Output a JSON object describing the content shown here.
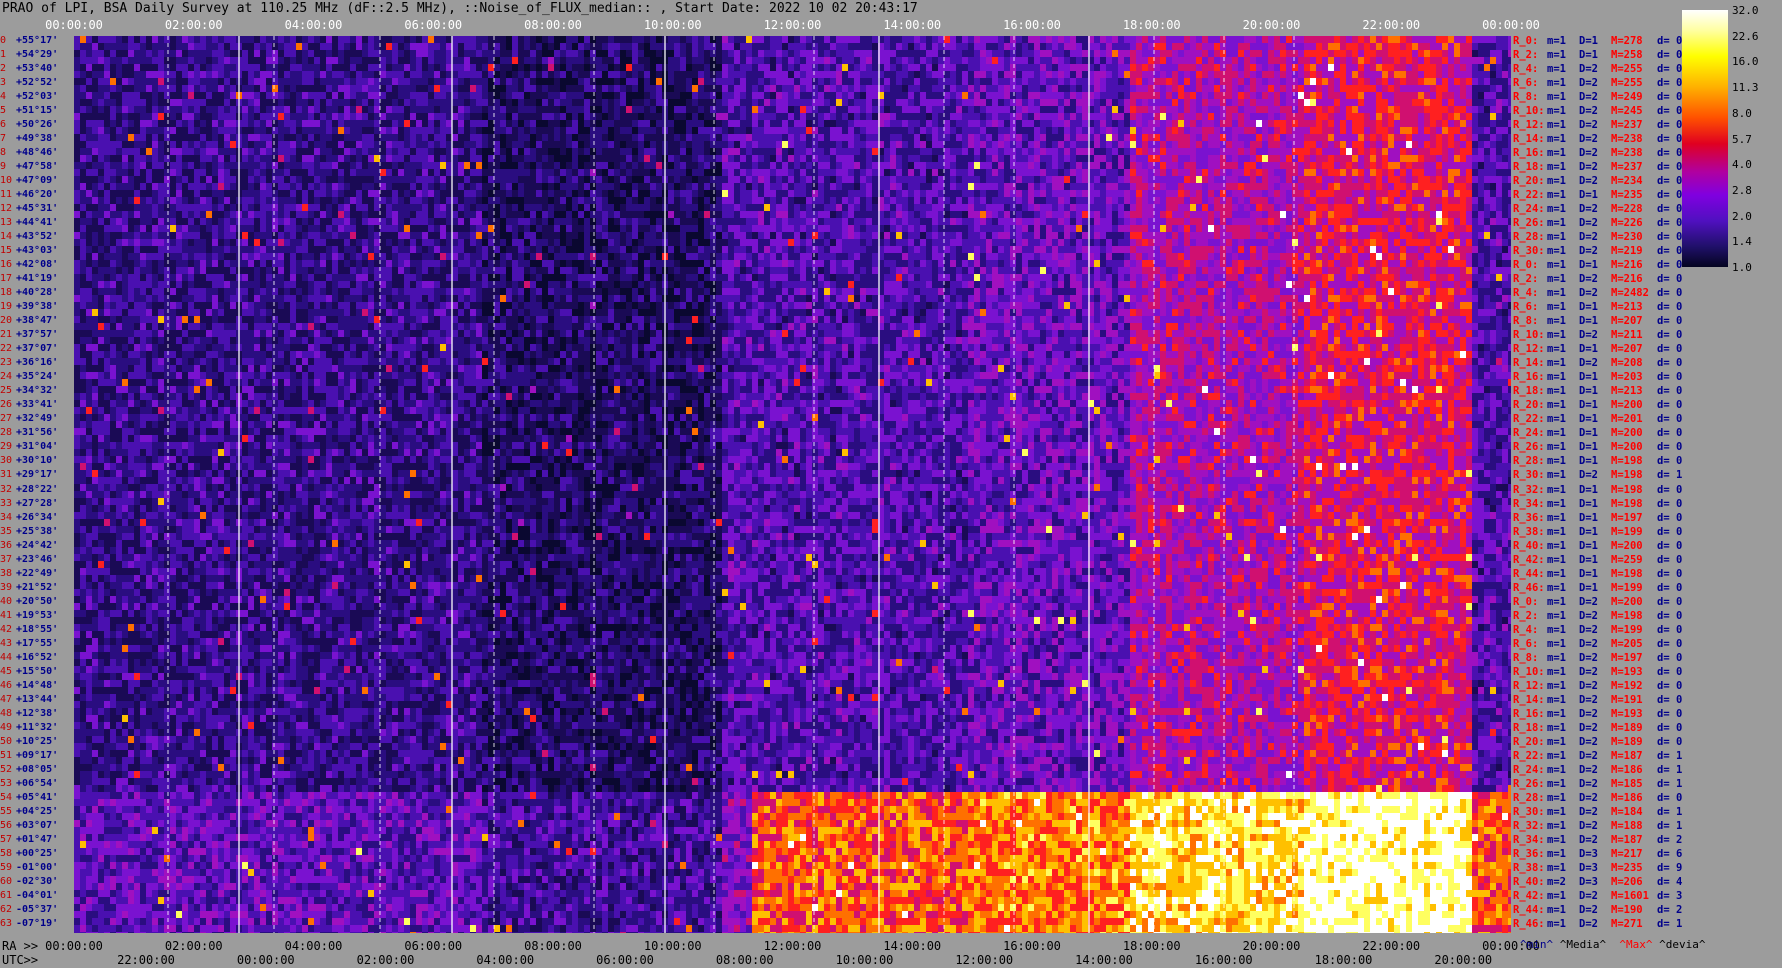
{
  "title": "PRAO of LPI, BSA Daily Survey at 110.25 MHz (dF::2.5 MHz), ::Noise_of_FLUX_median:: , Start Date: 2022 10 02 20:43:17",
  "top_axis": [
    "00:00:00",
    "02:00:00",
    "04:00:00",
    "06:00:00",
    "08:00:00",
    "10:00:00",
    "12:00:00",
    "14:00:00",
    "16:00:00",
    "18:00:00",
    "20:00:00",
    "22:00:00",
    "00:00:00"
  ],
  "bottom_ra_prefix": "RA >>",
  "bottom_ra": [
    "00:00:00",
    "02:00:00",
    "04:00:00",
    "06:00:00",
    "08:00:00",
    "10:00:00",
    "12:00:00",
    "14:00:00",
    "16:00:00",
    "18:00:00",
    "20:00:00",
    "22:00:00",
    "00:00:00"
  ],
  "bottom_utc_prefix": "UTC>>",
  "bottom_utc": [
    "22:00:00",
    "00:00:00",
    "02:00:00",
    "04:00:00",
    "06:00:00",
    "08:00:00",
    "10:00:00",
    "12:00:00",
    "14:00:00",
    "16:00:00",
    "18:00:00",
    "20:00:00"
  ],
  "colorbar": {
    "ticks": [
      "32.0",
      "22.6",
      "16.0",
      "11.3",
      "8.0",
      "5.7",
      "4.0",
      "2.8",
      "2.0",
      "1.4",
      "1.0"
    ]
  },
  "legend": {
    "min": "^min^",
    "median": "^Media^",
    "max": "^Max^",
    "devia": "^devia^"
  },
  "declinations": [
    {
      "i": "0",
      "d": "+55°17'"
    },
    {
      "i": "1",
      "d": "+54°29'"
    },
    {
      "i": "2",
      "d": "+53°40'"
    },
    {
      "i": "3",
      "d": "+52°52'"
    },
    {
      "i": "4",
      "d": "+52°03'"
    },
    {
      "i": "5",
      "d": "+51°15'"
    },
    {
      "i": "6",
      "d": "+50°26'"
    },
    {
      "i": "7",
      "d": "+49°38'"
    },
    {
      "i": "8",
      "d": "+48°46'"
    },
    {
      "i": "9",
      "d": "+47°58'"
    },
    {
      "i": "10",
      "d": "+47°09'"
    },
    {
      "i": "11",
      "d": "+46°20'"
    },
    {
      "i": "12",
      "d": "+45°31'"
    },
    {
      "i": "13",
      "d": "+44°41'"
    },
    {
      "i": "14",
      "d": "+43°52'"
    },
    {
      "i": "15",
      "d": "+43°03'"
    },
    {
      "i": "16",
      "d": "+42°08'"
    },
    {
      "i": "17",
      "d": "+41°19'"
    },
    {
      "i": "18",
      "d": "+40°28'"
    },
    {
      "i": "19",
      "d": "+39°38'"
    },
    {
      "i": "20",
      "d": "+38°47'"
    },
    {
      "i": "21",
      "d": "+37°57'"
    },
    {
      "i": "22",
      "d": "+37°07'"
    },
    {
      "i": "23",
      "d": "+36°16'"
    },
    {
      "i": "24",
      "d": "+35°24'"
    },
    {
      "i": "25",
      "d": "+34°32'"
    },
    {
      "i": "26",
      "d": "+33°41'"
    },
    {
      "i": "27",
      "d": "+32°49'"
    },
    {
      "i": "28",
      "d": "+31°56'"
    },
    {
      "i": "29",
      "d": "+31°04'"
    },
    {
      "i": "30",
      "d": "+30°10'"
    },
    {
      "i": "31",
      "d": "+29°17'"
    },
    {
      "i": "32",
      "d": "+28°22'"
    },
    {
      "i": "33",
      "d": "+27°28'"
    },
    {
      "i": "34",
      "d": "+26°34'"
    },
    {
      "i": "35",
      "d": "+25°38'"
    },
    {
      "i": "36",
      "d": "+24°42'"
    },
    {
      "i": "37",
      "d": "+23°46'"
    },
    {
      "i": "38",
      "d": "+22°49'"
    },
    {
      "i": "39",
      "d": "+21°52'"
    },
    {
      "i": "40",
      "d": "+20°50'"
    },
    {
      "i": "41",
      "d": "+19°53'"
    },
    {
      "i": "42",
      "d": "+18°55'"
    },
    {
      "i": "43",
      "d": "+17°55'"
    },
    {
      "i": "44",
      "d": "+16°52'"
    },
    {
      "i": "45",
      "d": "+15°50'"
    },
    {
      "i": "46",
      "d": "+14°48'"
    },
    {
      "i": "47",
      "d": "+13°44'"
    },
    {
      "i": "48",
      "d": "+12°38'"
    },
    {
      "i": "49",
      "d": "+11°32'"
    },
    {
      "i": "50",
      "d": "+10°25'"
    },
    {
      "i": "51",
      "d": "+09°17'"
    },
    {
      "i": "52",
      "d": "+08°05'"
    },
    {
      "i": "53",
      "d": "+06°54'"
    },
    {
      "i": "54",
      "d": "+05°41'"
    },
    {
      "i": "55",
      "d": "+04°25'"
    },
    {
      "i": "56",
      "d": "+03°07'"
    },
    {
      "i": "57",
      "d": "+01°47'"
    },
    {
      "i": "58",
      "d": "+00°25'"
    },
    {
      "i": "59",
      "d": "-01°00'"
    },
    {
      "i": "60",
      "d": "-02°30'"
    },
    {
      "i": "61",
      "d": "-04°01'"
    },
    {
      "i": "62",
      "d": "-05°37'"
    },
    {
      "i": "63",
      "d": "-07°19'"
    }
  ],
  "stats": [
    {
      "r": "R_0:",
      "m": "m=1",
      "D": "D=1",
      "M": "M=278",
      "d": "d= 0"
    },
    {
      "r": "R_2:",
      "m": "m=1",
      "D": "D=1",
      "M": "M=258",
      "d": "d= 0"
    },
    {
      "r": "R_4:",
      "m": "m=1",
      "D": "D=2",
      "M": "M=255",
      "d": "d= 0"
    },
    {
      "r": "R_6:",
      "m": "m=1",
      "D": "D=2",
      "M": "M=255",
      "d": "d= 0"
    },
    {
      "r": "R_8:",
      "m": "m=1",
      "D": "D=2",
      "M": "M=249",
      "d": "d= 0"
    },
    {
      "r": "R_10:",
      "m": "m=1",
      "D": "D=2",
      "M": "M=245",
      "d": "d= 0"
    },
    {
      "r": "R_12:",
      "m": "m=1",
      "D": "D=2",
      "M": "M=237",
      "d": "d= 0"
    },
    {
      "r": "R_14:",
      "m": "m=1",
      "D": "D=2",
      "M": "M=238",
      "d": "d= 0"
    },
    {
      "r": "R_16:",
      "m": "m=1",
      "D": "D=2",
      "M": "M=238",
      "d": "d= 0"
    },
    {
      "r": "R_18:",
      "m": "m=1",
      "D": "D=2",
      "M": "M=237",
      "d": "d= 0"
    },
    {
      "r": "R_20:",
      "m": "m=1",
      "D": "D=2",
      "M": "M=234",
      "d": "d= 0"
    },
    {
      "r": "R_22:",
      "m": "m=1",
      "D": "D=1",
      "M": "M=235",
      "d": "d= 0"
    },
    {
      "r": "R_24:",
      "m": "m=1",
      "D": "D=2",
      "M": "M=228",
      "d": "d= 0"
    },
    {
      "r": "R_26:",
      "m": "m=1",
      "D": "D=2",
      "M": "M=226",
      "d": "d= 0"
    },
    {
      "r": "R_28:",
      "m": "m=1",
      "D": "D=2",
      "M": "M=230",
      "d": "d= 0"
    },
    {
      "r": "R_30:",
      "m": "m=1",
      "D": "D=2",
      "M": "M=219",
      "d": "d= 0"
    },
    {
      "r": "R_0:",
      "m": "m=1",
      "D": "D=1",
      "M": "M=216",
      "d": "d= 0"
    },
    {
      "r": "R_2:",
      "m": "m=1",
      "D": "D=2",
      "M": "M=216",
      "d": "d= 0"
    },
    {
      "r": "R_4:",
      "m": "m=1",
      "D": "D=2",
      "M": "M=2482",
      "d": "d= 0"
    },
    {
      "r": "R_6:",
      "m": "m=1",
      "D": "D=1",
      "M": "M=213",
      "d": "d= 0"
    },
    {
      "r": "R_8:",
      "m": "m=1",
      "D": "D=1",
      "M": "M=207",
      "d": "d= 0"
    },
    {
      "r": "R_10:",
      "m": "m=1",
      "D": "D=2",
      "M": "M=211",
      "d": "d= 0"
    },
    {
      "r": "R_12:",
      "m": "m=1",
      "D": "D=1",
      "M": "M=207",
      "d": "d= 0"
    },
    {
      "r": "R_14:",
      "m": "m=1",
      "D": "D=2",
      "M": "M=208",
      "d": "d= 0"
    },
    {
      "r": "R_16:",
      "m": "m=1",
      "D": "D=1",
      "M": "M=203",
      "d": "d= 0"
    },
    {
      "r": "R_18:",
      "m": "m=1",
      "D": "D=1",
      "M": "M=213",
      "d": "d= 0"
    },
    {
      "r": "R_20:",
      "m": "m=1",
      "D": "D=1",
      "M": "M=200",
      "d": "d= 0"
    },
    {
      "r": "R_22:",
      "m": "m=1",
      "D": "D=1",
      "M": "M=201",
      "d": "d= 0"
    },
    {
      "r": "R_24:",
      "m": "m=1",
      "D": "D=1",
      "M": "M=200",
      "d": "d= 0"
    },
    {
      "r": "R_26:",
      "m": "m=1",
      "D": "D=1",
      "M": "M=200",
      "d": "d= 0"
    },
    {
      "r": "R_28:",
      "m": "m=1",
      "D": "D=1",
      "M": "M=198",
      "d": "d= 0"
    },
    {
      "r": "R_30:",
      "m": "m=1",
      "D": "D=2",
      "M": "M=198",
      "d": "d= 1"
    },
    {
      "r": "R_32:",
      "m": "m=1",
      "D": "D=1",
      "M": "M=198",
      "d": "d= 0"
    },
    {
      "r": "R_34:",
      "m": "m=1",
      "D": "D=1",
      "M": "M=198",
      "d": "d= 0"
    },
    {
      "r": "R_36:",
      "m": "m=1",
      "D": "D=1",
      "M": "M=197",
      "d": "d= 0"
    },
    {
      "r": "R_38:",
      "m": "m=1",
      "D": "D=1",
      "M": "M=199",
      "d": "d= 0"
    },
    {
      "r": "R_40:",
      "m": "m=1",
      "D": "D=1",
      "M": "M=200",
      "d": "d= 0"
    },
    {
      "r": "R_42:",
      "m": "m=1",
      "D": "D=1",
      "M": "M=259",
      "d": "d= 0"
    },
    {
      "r": "R_44:",
      "m": "m=1",
      "D": "D=1",
      "M": "M=198",
      "d": "d= 0"
    },
    {
      "r": "R_46:",
      "m": "m=1",
      "D": "D=1",
      "M": "M=199",
      "d": "d= 0"
    },
    {
      "r": "R_0:",
      "m": "m=1",
      "D": "D=2",
      "M": "M=200",
      "d": "d= 0"
    },
    {
      "r": "R_2:",
      "m": "m=1",
      "D": "D=2",
      "M": "M=198",
      "d": "d= 0"
    },
    {
      "r": "R_4:",
      "m": "m=1",
      "D": "D=2",
      "M": "M=199",
      "d": "d= 0"
    },
    {
      "r": "R_6:",
      "m": "m=1",
      "D": "D=2",
      "M": "M=205",
      "d": "d= 0"
    },
    {
      "r": "R_8:",
      "m": "m=1",
      "D": "D=2",
      "M": "M=197",
      "d": "d= 0"
    },
    {
      "r": "R_10:",
      "m": "m=1",
      "D": "D=2",
      "M": "M=193",
      "d": "d= 0"
    },
    {
      "r": "R_12:",
      "m": "m=1",
      "D": "D=2",
      "M": "M=192",
      "d": "d= 0"
    },
    {
      "r": "R_14:",
      "m": "m=1",
      "D": "D=2",
      "M": "M=191",
      "d": "d= 0"
    },
    {
      "r": "R_16:",
      "m": "m=1",
      "D": "D=2",
      "M": "M=193",
      "d": "d= 0"
    },
    {
      "r": "R_18:",
      "m": "m=1",
      "D": "D=2",
      "M": "M=189",
      "d": "d= 0"
    },
    {
      "r": "R_20:",
      "m": "m=1",
      "D": "D=2",
      "M": "M=189",
      "d": "d= 0"
    },
    {
      "r": "R_22:",
      "m": "m=1",
      "D": "D=2",
      "M": "M=187",
      "d": "d= 1"
    },
    {
      "r": "R_24:",
      "m": "m=1",
      "D": "D=2",
      "M": "M=186",
      "d": "d= 1"
    },
    {
      "r": "R_26:",
      "m": "m=1",
      "D": "D=2",
      "M": "M=185",
      "d": "d= 1"
    },
    {
      "r": "R_28:",
      "m": "m=1",
      "D": "D=2",
      "M": "M=186",
      "d": "d= 0"
    },
    {
      "r": "R_30:",
      "m": "m=1",
      "D": "D=2",
      "M": "M=184",
      "d": "d= 1"
    },
    {
      "r": "R_32:",
      "m": "m=1",
      "D": "D=2",
      "M": "M=188",
      "d": "d= 1"
    },
    {
      "r": "R_34:",
      "m": "m=1",
      "D": "D=2",
      "M": "M=187",
      "d": "d= 2"
    },
    {
      "r": "R_36:",
      "m": "m=1",
      "D": "D=3",
      "M": "M=217",
      "d": "d= 6"
    },
    {
      "r": "R_38:",
      "m": "m=1",
      "D": "D=3",
      "M": "M=235",
      "d": "d= 9"
    },
    {
      "r": "R_40:",
      "m": "m=2",
      "D": "D=3",
      "M": "M=206",
      "d": "d= 4"
    },
    {
      "r": "R_42:",
      "m": "m=1",
      "D": "D=2",
      "M": "M=1601",
      "d": "d= 3"
    },
    {
      "r": "R_44:",
      "m": "m=1",
      "D": "D=2",
      "M": "M=190",
      "d": "d= 2"
    },
    {
      "r": "R_46:",
      "m": "m=1",
      "D": "D=2",
      "M": "M=271",
      "d": "d= 1"
    }
  ]
}
